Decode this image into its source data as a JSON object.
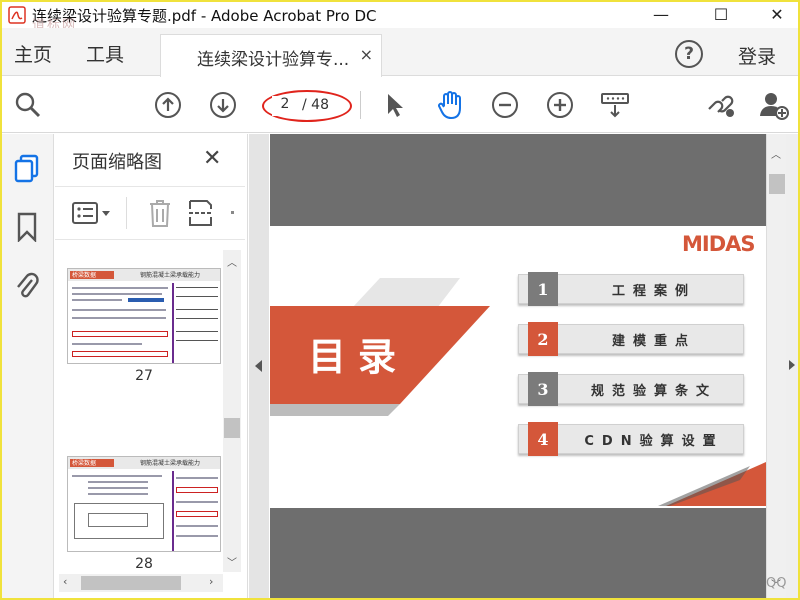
{
  "window": {
    "title": "连续梁设计验算专题.pdf - Adobe Acrobat Pro DC",
    "watermark": "道标网",
    "controls": {
      "minimize": "—",
      "maximize": "☐",
      "close": "✕"
    }
  },
  "tabs": {
    "home": "主页",
    "tools": "工具",
    "document": "连续梁设计验算专...",
    "document_close": "×",
    "help": "?",
    "login": "登录"
  },
  "toolbar": {
    "current_page": "2",
    "total_pages": "/ 48",
    "icons": [
      "search-icon",
      "page-up-icon",
      "page-down-icon",
      "pointer-icon",
      "hand-icon",
      "zoom-out-icon",
      "zoom-in-icon",
      "fit-page-icon",
      "share-link-icon",
      "add-user-icon"
    ]
  },
  "panel": {
    "title": "页面缩略图",
    "close": "✕",
    "thumbnails": [
      {
        "page": "27",
        "header": "桥梁数据",
        "subheader": "钢筋混凝土梁承载能力"
      },
      {
        "page": "28",
        "header": "桥梁数据",
        "subheader": "钢筋混凝土梁承载能力"
      }
    ]
  },
  "document": {
    "logo": "MIDAS",
    "heading": "目录",
    "agenda": [
      {
        "num": "1",
        "label": "工程案例",
        "accent": "#7b7b7b"
      },
      {
        "num": "2",
        "label": "建模重点",
        "accent": "#d4573a"
      },
      {
        "num": "3",
        "label": "规范验算条文",
        "accent": "#7b7b7b"
      },
      {
        "num": "4",
        "label": "CDN验算设置",
        "accent": "#d4573a"
      }
    ],
    "corner_mark": "QQ"
  },
  "colors": {
    "accent_red": "#d4573a",
    "highlight_ellipse": "#e0241c",
    "active_blue": "#1473e6",
    "doc_background": "#6e6e6e"
  }
}
